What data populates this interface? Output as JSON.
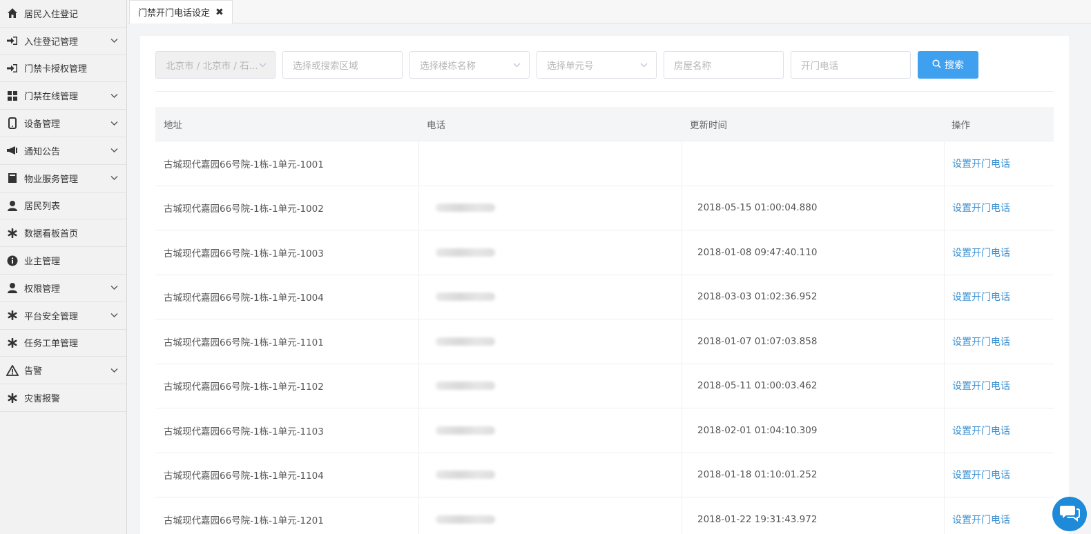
{
  "sidebar": {
    "items": [
      {
        "label": "居民入住登记",
        "icon": "home-icon",
        "chevron": false
      },
      {
        "label": "入住登记管理",
        "icon": "sign-in-icon",
        "chevron": true
      },
      {
        "label": "门禁卡授权管理",
        "icon": "sign-in-icon",
        "chevron": false
      },
      {
        "label": "门禁在线管理",
        "icon": "grid-icon",
        "chevron": true
      },
      {
        "label": "设备管理",
        "icon": "mobile-icon",
        "chevron": true
      },
      {
        "label": "通知公告",
        "icon": "megaphone-icon",
        "chevron": true
      },
      {
        "label": "物业服务管理",
        "icon": "book-icon",
        "chevron": true
      },
      {
        "label": "居民列表",
        "icon": "user-icon",
        "chevron": false
      },
      {
        "label": "数据看板首页",
        "icon": "asterisk-icon",
        "chevron": false
      },
      {
        "label": "业主管理",
        "icon": "info-icon",
        "chevron": false
      },
      {
        "label": "权限管理",
        "icon": "user-icon",
        "chevron": true
      },
      {
        "label": "平台安全管理",
        "icon": "asterisk-icon",
        "chevron": true
      },
      {
        "label": "任务工单管理",
        "icon": "asterisk-icon",
        "chevron": false
      },
      {
        "label": "告警",
        "icon": "warning-icon",
        "chevron": true
      },
      {
        "label": "灾害报警",
        "icon": "asterisk-icon",
        "chevron": false
      }
    ]
  },
  "tabs": [
    {
      "label": "门禁开门电话设定",
      "close": "✖"
    }
  ],
  "filter": {
    "region_value": "北京市 / 北京市 / 石...",
    "area_placeholder": "选择或搜索区域",
    "building_placeholder": "选择楼栋名称",
    "unit_placeholder": "选择单元号",
    "room_placeholder": "房屋名称",
    "phone_placeholder": "开门电话",
    "search_label": "搜索"
  },
  "table": {
    "headers": [
      "地址",
      "电话",
      "更新时间",
      "操作"
    ],
    "rows": [
      {
        "address": "古城现代嘉园66号院-1栋-1单元-1001",
        "phone_blurred": false,
        "time": "",
        "action": "设置开门电话"
      },
      {
        "address": "古城现代嘉园66号院-1栋-1单元-1002",
        "phone_blurred": true,
        "time": "2018-05-15 01:00:04.880",
        "action": "设置开门电话"
      },
      {
        "address": "古城现代嘉园66号院-1栋-1单元-1003",
        "phone_blurred": true,
        "time": "2018-01-08 09:47:40.110",
        "action": "设置开门电话"
      },
      {
        "address": "古城现代嘉园66号院-1栋-1单元-1004",
        "phone_blurred": true,
        "time": "2018-03-03 01:02:36.952",
        "action": "设置开门电话"
      },
      {
        "address": "古城现代嘉园66号院-1栋-1单元-1101",
        "phone_blurred": true,
        "time": "2018-01-07 01:07:03.858",
        "action": "设置开门电话"
      },
      {
        "address": "古城现代嘉园66号院-1栋-1单元-1102",
        "phone_blurred": true,
        "time": "2018-05-11 01:00:03.462",
        "action": "设置开门电话"
      },
      {
        "address": "古城现代嘉园66号院-1栋-1单元-1103",
        "phone_blurred": true,
        "time": "2018-02-01 01:04:10.309",
        "action": "设置开门电话"
      },
      {
        "address": "古城现代嘉园66号院-1栋-1单元-1104",
        "phone_blurred": true,
        "time": "2018-01-18 01:10:01.252",
        "action": "设置开门电话"
      },
      {
        "address": "古城现代嘉园66号院-1栋-1单元-1201",
        "phone_blurred": true,
        "time": "2018-01-22 19:31:43.972",
        "action": "设置开门电话"
      }
    ]
  },
  "colors": {
    "accent": "#3fa0f0",
    "link": "#3a8fd0",
    "chat": "#1e8ad8"
  }
}
